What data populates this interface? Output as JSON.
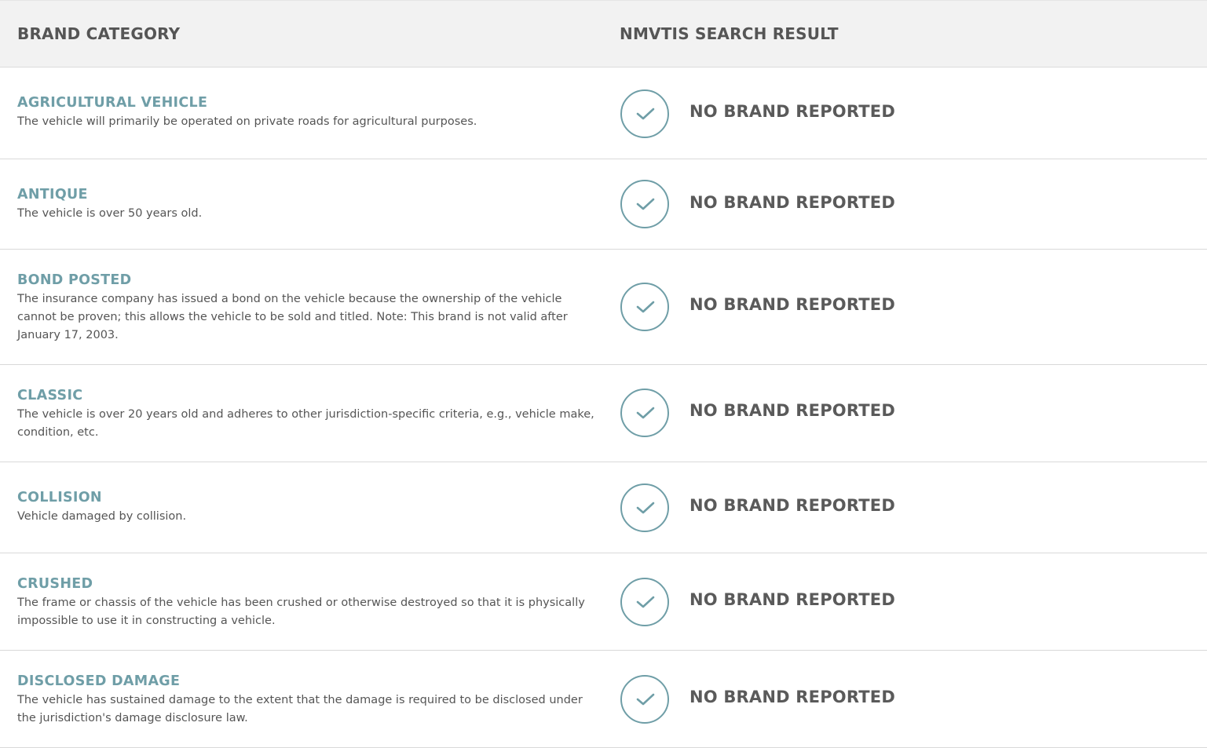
{
  "header": {
    "col1": "BRAND CATEGORY",
    "col2": "NMVTIS SEARCH RESULT"
  },
  "colors": {
    "accent": "#6f9ea7",
    "header_bg": "#f2f2f2",
    "text": "#555555"
  },
  "rows": [
    {
      "name": "AGRICULTURAL VEHICLE",
      "description": "The vehicle will primarily be operated on private roads for agricultural purposes.",
      "result": "NO BRAND REPORTED",
      "icon": "check-circle-icon"
    },
    {
      "name": "ANTIQUE",
      "description": "The vehicle is over 50 years old.",
      "result": "NO BRAND REPORTED",
      "icon": "check-circle-icon"
    },
    {
      "name": "BOND POSTED",
      "description": "The insurance company has issued a bond on the vehicle because the ownership of the vehicle cannot be proven; this allows the vehicle to be sold and titled. Note: This brand is not valid after January 17, 2003.",
      "result": "NO BRAND REPORTED",
      "icon": "check-circle-icon"
    },
    {
      "name": "CLASSIC",
      "description": "The vehicle is over 20 years old and adheres to other jurisdiction-specific criteria, e.g., vehicle make, condition, etc.",
      "result": "NO BRAND REPORTED",
      "icon": "check-circle-icon"
    },
    {
      "name": "COLLISION",
      "description": "Vehicle damaged by collision.",
      "result": "NO BRAND REPORTED",
      "icon": "check-circle-icon"
    },
    {
      "name": "CRUSHED",
      "description": "The frame or chassis of the vehicle has been crushed or otherwise destroyed so that it is physically impossible to use it in constructing a vehicle.",
      "result": "NO BRAND REPORTED",
      "icon": "check-circle-icon"
    },
    {
      "name": "DISCLOSED DAMAGE",
      "description": "The vehicle has sustained damage to the extent that the damage is required to be disclosed under the jurisdiction's damage disclosure law.",
      "result": "NO BRAND REPORTED",
      "icon": "check-circle-icon"
    }
  ]
}
